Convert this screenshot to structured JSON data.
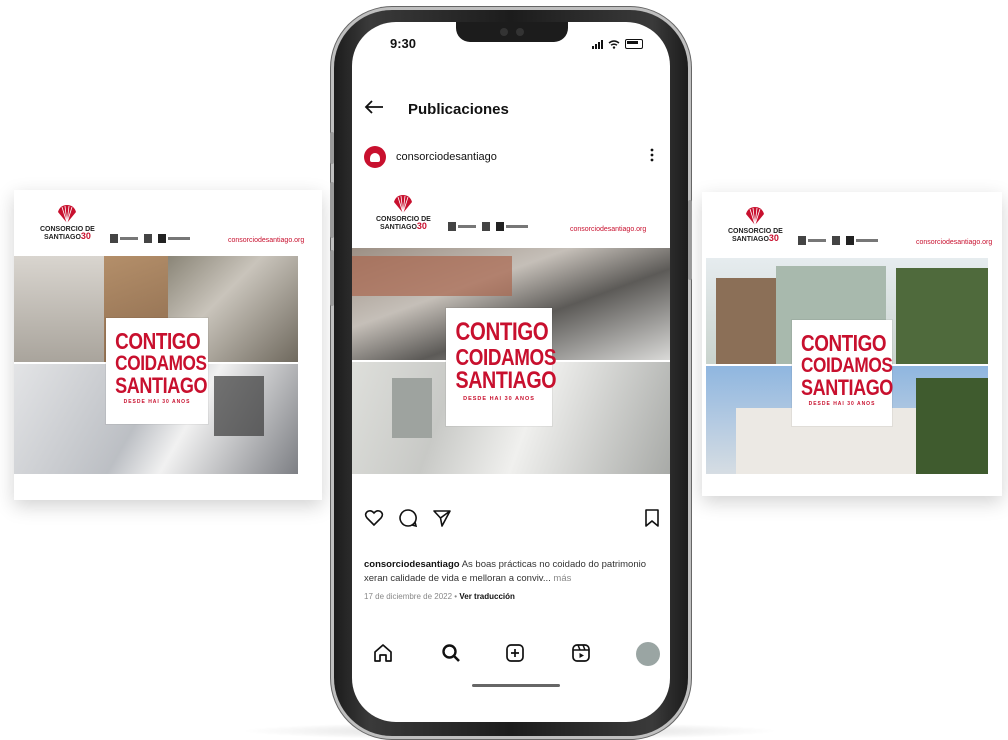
{
  "phone": {
    "status_time": "9:30",
    "nav_title": "Publicaciones",
    "post": {
      "username": "consorciodesantiago",
      "caption_text": "As boas prácticas no coidado do patrimonio xeran calidade de vida e melloran a conviv...",
      "caption_more": "más",
      "date": "17 de diciembre de 2022",
      "separator": "•",
      "translate_label": "Ver traducción"
    }
  },
  "brand": {
    "logo_line1": "CONSORCIO DE",
    "logo_line2": "SANTIAGO",
    "logo_30": "30",
    "url": "consorciodesantiago.org",
    "gov1": "GOBIERNO DE ESPAÑA",
    "gov3": "XUNTA DE GALICIA",
    "color": "#c8102e"
  },
  "promo": {
    "line1": "CONTIGO",
    "line2": "COIDAMOS",
    "line3": "SANTIAGO",
    "sub": "DESDE HAI 30 ANOS"
  },
  "icons": {
    "back": "arrow-left",
    "more": "vertical-dots",
    "like": "heart-outline",
    "comment": "comment-bubble",
    "share": "paper-plane",
    "save": "bookmark-outline",
    "home": "home",
    "search": "magnifier",
    "create": "plus-square",
    "reels": "reels"
  }
}
